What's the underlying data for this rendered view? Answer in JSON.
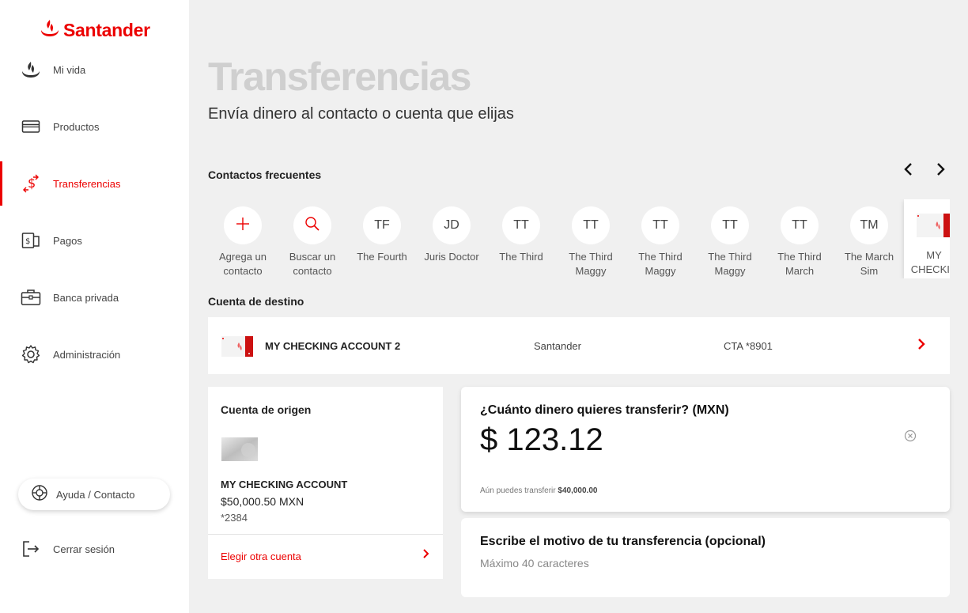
{
  "brand": {
    "name": "Santander",
    "color": "#ec0000"
  },
  "sidebar": {
    "items": [
      {
        "label": "Mi vida",
        "icon": "flame-icon"
      },
      {
        "label": "Productos",
        "icon": "card-icon"
      },
      {
        "label": "Transferencias",
        "icon": "transfer-icon",
        "active": true
      },
      {
        "label": "Pagos",
        "icon": "bill-icon"
      },
      {
        "label": "Banca privada",
        "icon": "briefcase-icon"
      },
      {
        "label": "Administración",
        "icon": "gear-icon"
      }
    ],
    "help_label": "Ayuda / Contacto",
    "logout_label": "Cerrar sesión"
  },
  "header": {
    "title": "Transferencias",
    "subtitle": "Envía dinero al contacto o cuenta que elijas"
  },
  "contacts": {
    "section_label": "Contactos frecuentes",
    "items": [
      {
        "initials": "+",
        "name": "Agrega un contacto",
        "icon": "plus-icon"
      },
      {
        "initials": "",
        "name": "Buscar un contacto",
        "icon": "search-icon"
      },
      {
        "initials": "TF",
        "name": "The Fourth"
      },
      {
        "initials": "JD",
        "name": "Juris Doctor"
      },
      {
        "initials": "TT",
        "name": "The Third"
      },
      {
        "initials": "TT",
        "name": "The Third Maggy"
      },
      {
        "initials": "TT",
        "name": "The Third Maggy"
      },
      {
        "initials": "TT",
        "name": "The Third Maggy"
      },
      {
        "initials": "TT",
        "name": "The Third March"
      },
      {
        "initials": "TM",
        "name": "The March Sim"
      },
      {
        "initials": "",
        "name": "MY CHECKIN",
        "icon": "account-card-icon"
      }
    ]
  },
  "destination": {
    "section_label": "Cuenta de destino",
    "account_name": "MY CHECKING ACCOUNT 2",
    "bank": "Santander",
    "account_number": "CTA *8901"
  },
  "origin": {
    "title": "Cuenta de origen",
    "account_name": "MY CHECKING ACCOUNT",
    "balance": "$50,000.50 MXN",
    "number": "*2384",
    "choose_label": "Elegir otra cuenta"
  },
  "amount": {
    "question": "¿Cuánto dinero quieres transferir? (MXN)",
    "value": "$ 123.12",
    "limit_prefix": "Aún puedes transferir",
    "limit_value": "$40,000.00"
  },
  "motive": {
    "question": "Escribe el motivo de tu transferencia (opcional)",
    "placeholder": "Máximo 40 caracteres"
  }
}
